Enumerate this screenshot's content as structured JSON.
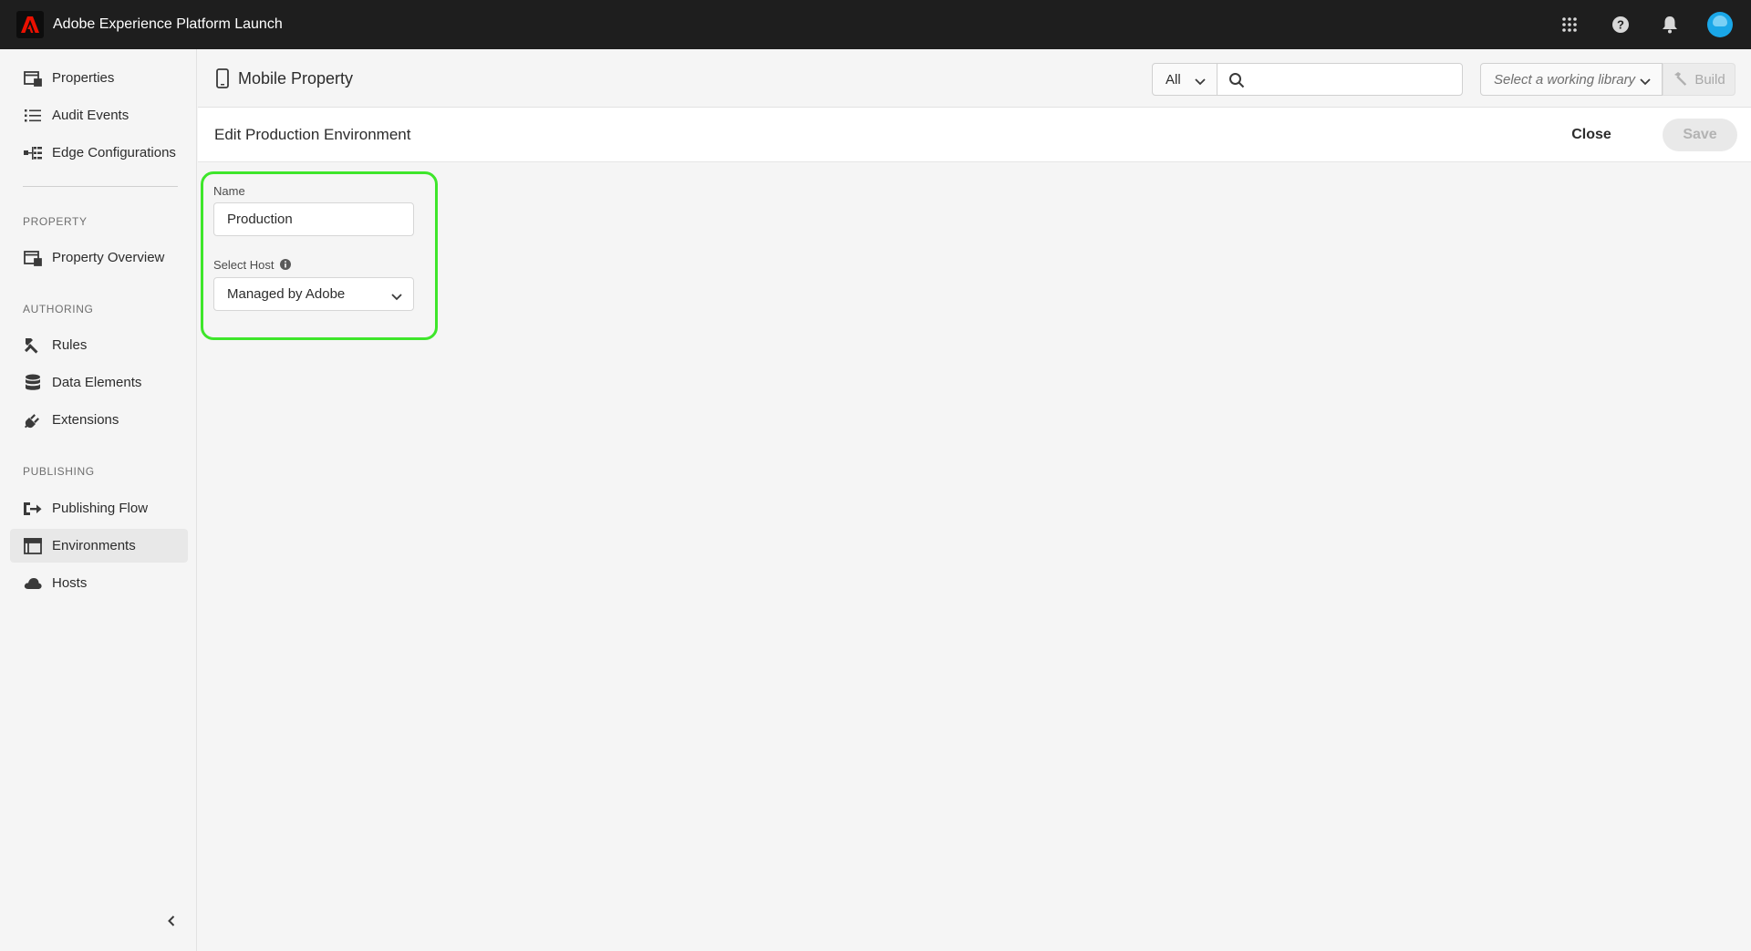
{
  "app": {
    "title": "Adobe Experience Platform Launch",
    "brand_color": "#eb1000"
  },
  "topbar": {
    "icons": [
      "apps-grid-icon",
      "help-icon",
      "notifications-bell-icon",
      "user-avatar"
    ]
  },
  "sidebar": {
    "top_items": [
      {
        "label": "Properties",
        "icon": "properties-icon"
      },
      {
        "label": "Audit Events",
        "icon": "list-icon"
      },
      {
        "label": "Edge Configurations",
        "icon": "edge-config-icon"
      }
    ],
    "sections": {
      "property": "PROPERTY",
      "authoring": "AUTHORING",
      "publishing": "PUBLISHING"
    },
    "property_items": [
      {
        "label": "Property Overview",
        "icon": "properties-icon"
      }
    ],
    "authoring_items": [
      {
        "label": "Rules",
        "icon": "rules-icon"
      },
      {
        "label": "Data Elements",
        "icon": "database-icon"
      },
      {
        "label": "Extensions",
        "icon": "plug-icon"
      }
    ],
    "publishing_items": [
      {
        "label": "Publishing Flow",
        "icon": "publishing-flow-icon"
      },
      {
        "label": "Environments",
        "icon": "environments-icon",
        "active": true
      },
      {
        "label": "Hosts",
        "icon": "cloud-icon"
      }
    ]
  },
  "header": {
    "property_name": "Mobile Property",
    "filter_value": "All",
    "search_value": "",
    "library_placeholder": "Select a working library",
    "build_label": "Build"
  },
  "editbar": {
    "title": "Edit Production Environment",
    "close_label": "Close",
    "save_label": "Save"
  },
  "form": {
    "name_label": "Name",
    "name_value": "Production",
    "host_label": "Select Host",
    "host_value": "Managed by Adobe",
    "highlight_color": "#3ee62b"
  }
}
